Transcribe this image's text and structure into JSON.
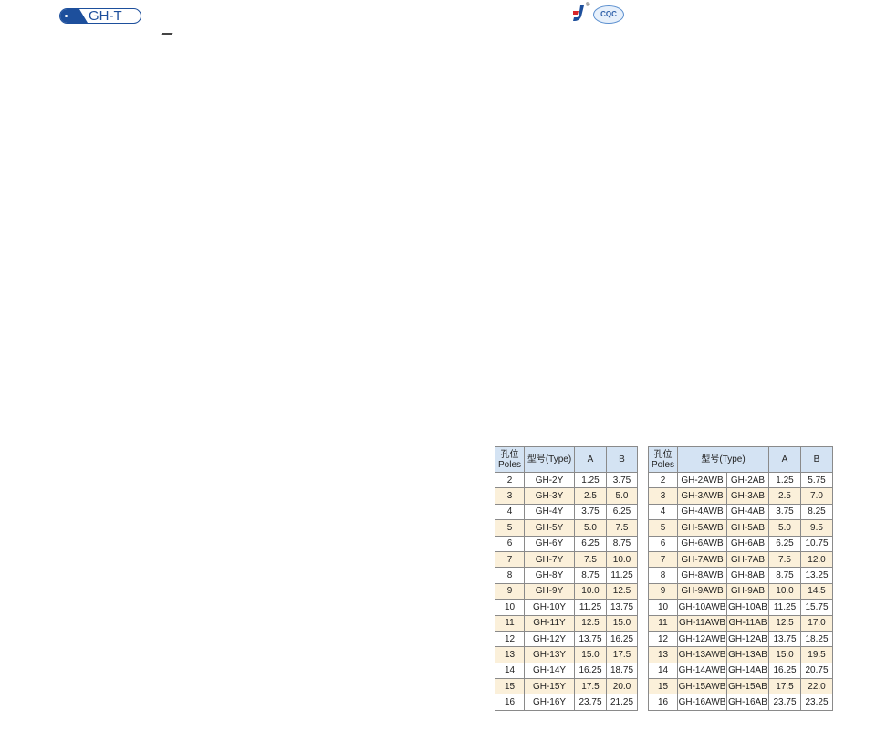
{
  "header": {
    "series_label": "GH-T",
    "cert_logo_text": "CQC",
    "registered_mark": "®"
  },
  "table1": {
    "headers": {
      "poles": "孔位\nPoles",
      "type": "型号(Type)",
      "a": "A",
      "b": "B"
    },
    "rows": [
      [
        "2",
        "GH-2Y",
        "1.25",
        "3.75"
      ],
      [
        "3",
        "GH-3Y",
        "2.5",
        "5.0"
      ],
      [
        "4",
        "GH-4Y",
        "3.75",
        "6.25"
      ],
      [
        "5",
        "GH-5Y",
        "5.0",
        "7.5"
      ],
      [
        "6",
        "GH-6Y",
        "6.25",
        "8.75"
      ],
      [
        "7",
        "GH-7Y",
        "7.5",
        "10.0"
      ],
      [
        "8",
        "GH-8Y",
        "8.75",
        "11.25"
      ],
      [
        "9",
        "GH-9Y",
        "10.0",
        "12.5"
      ],
      [
        "10",
        "GH-10Y",
        "11.25",
        "13.75"
      ],
      [
        "11",
        "GH-11Y",
        "12.5",
        "15.0"
      ],
      [
        "12",
        "GH-12Y",
        "13.75",
        "16.25"
      ],
      [
        "13",
        "GH-13Y",
        "15.0",
        "17.5"
      ],
      [
        "14",
        "GH-14Y",
        "16.25",
        "18.75"
      ],
      [
        "15",
        "GH-15Y",
        "17.5",
        "20.0"
      ],
      [
        "16",
        "GH-16Y",
        "23.75",
        "21.25"
      ]
    ]
  },
  "table2": {
    "headers": {
      "poles": "孔位\nPoles",
      "type": "型号(Type)",
      "a": "A",
      "b": "B"
    },
    "rows": [
      [
        "2",
        "GH-2AWB",
        "GH-2AB",
        "1.25",
        "5.75"
      ],
      [
        "3",
        "GH-3AWB",
        "GH-3AB",
        "2.5",
        "7.0"
      ],
      [
        "4",
        "GH-4AWB",
        "GH-4AB",
        "3.75",
        "8.25"
      ],
      [
        "5",
        "GH-5AWB",
        "GH-5AB",
        "5.0",
        "9.5"
      ],
      [
        "6",
        "GH-6AWB",
        "GH-6AB",
        "6.25",
        "10.75"
      ],
      [
        "7",
        "GH-7AWB",
        "GH-7AB",
        "7.5",
        "12.0"
      ],
      [
        "8",
        "GH-8AWB",
        "GH-8AB",
        "8.75",
        "13.25"
      ],
      [
        "9",
        "GH-9AWB",
        "GH-9AB",
        "10.0",
        "14.5"
      ],
      [
        "10",
        "GH-10AWB",
        "GH-10AB",
        "11.25",
        "15.75"
      ],
      [
        "11",
        "GH-11AWB",
        "GH-11AB",
        "12.5",
        "17.0"
      ],
      [
        "12",
        "GH-12AWB",
        "GH-12AB",
        "13.75",
        "18.25"
      ],
      [
        "13",
        "GH-13AWB",
        "GH-13AB",
        "15.0",
        "19.5"
      ],
      [
        "14",
        "GH-14AWB",
        "GH-14AB",
        "16.25",
        "20.75"
      ],
      [
        "15",
        "GH-15AWB",
        "GH-15AB",
        "17.5",
        "22.0"
      ],
      [
        "16",
        "GH-16AWB",
        "GH-16AB",
        "23.75",
        "23.25"
      ]
    ]
  }
}
